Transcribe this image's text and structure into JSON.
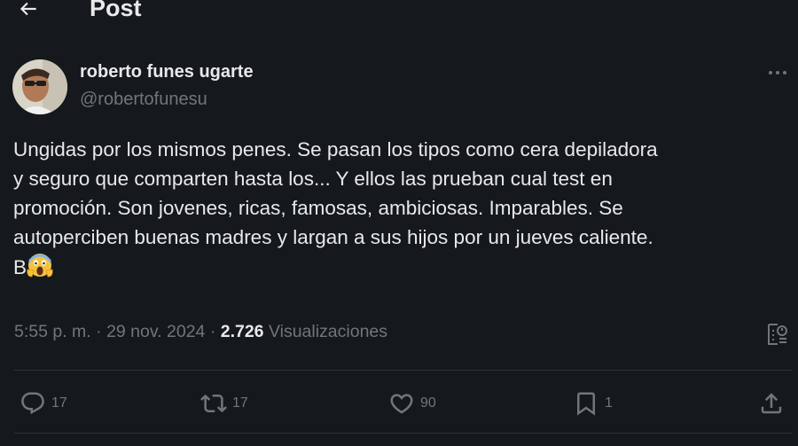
{
  "header": {
    "title": "Post",
    "back_icon": "arrow-left-icon"
  },
  "post": {
    "author_name": "roberto funes ugarte",
    "author_handle": "@robertofunesu",
    "text": "Ungidas por los mismos penes. Se pasan los tipos como cera depiladora\ny seguro que comparten hasta los... Y ellos las prueban cual test en\npromoción. Son jovenes, ricas, famosas, ambiciosas. Imparables. Se\nautoperciben buenas madres y largan a sus hijos por un jueves caliente.\nB",
    "emoji": "😱",
    "time": "5:55 p. m.",
    "separator": "·",
    "date": "29 nov. 2024",
    "views_count": "2.726",
    "views_label": "Visualizaciones"
  },
  "actions": {
    "replies": "17",
    "reposts": "17",
    "likes": "90",
    "bookmarks": "1"
  },
  "colors": {
    "background": "#15181c",
    "text_primary": "#e7e9ea",
    "text_secondary": "#71767b",
    "divider": "#2f3336"
  }
}
